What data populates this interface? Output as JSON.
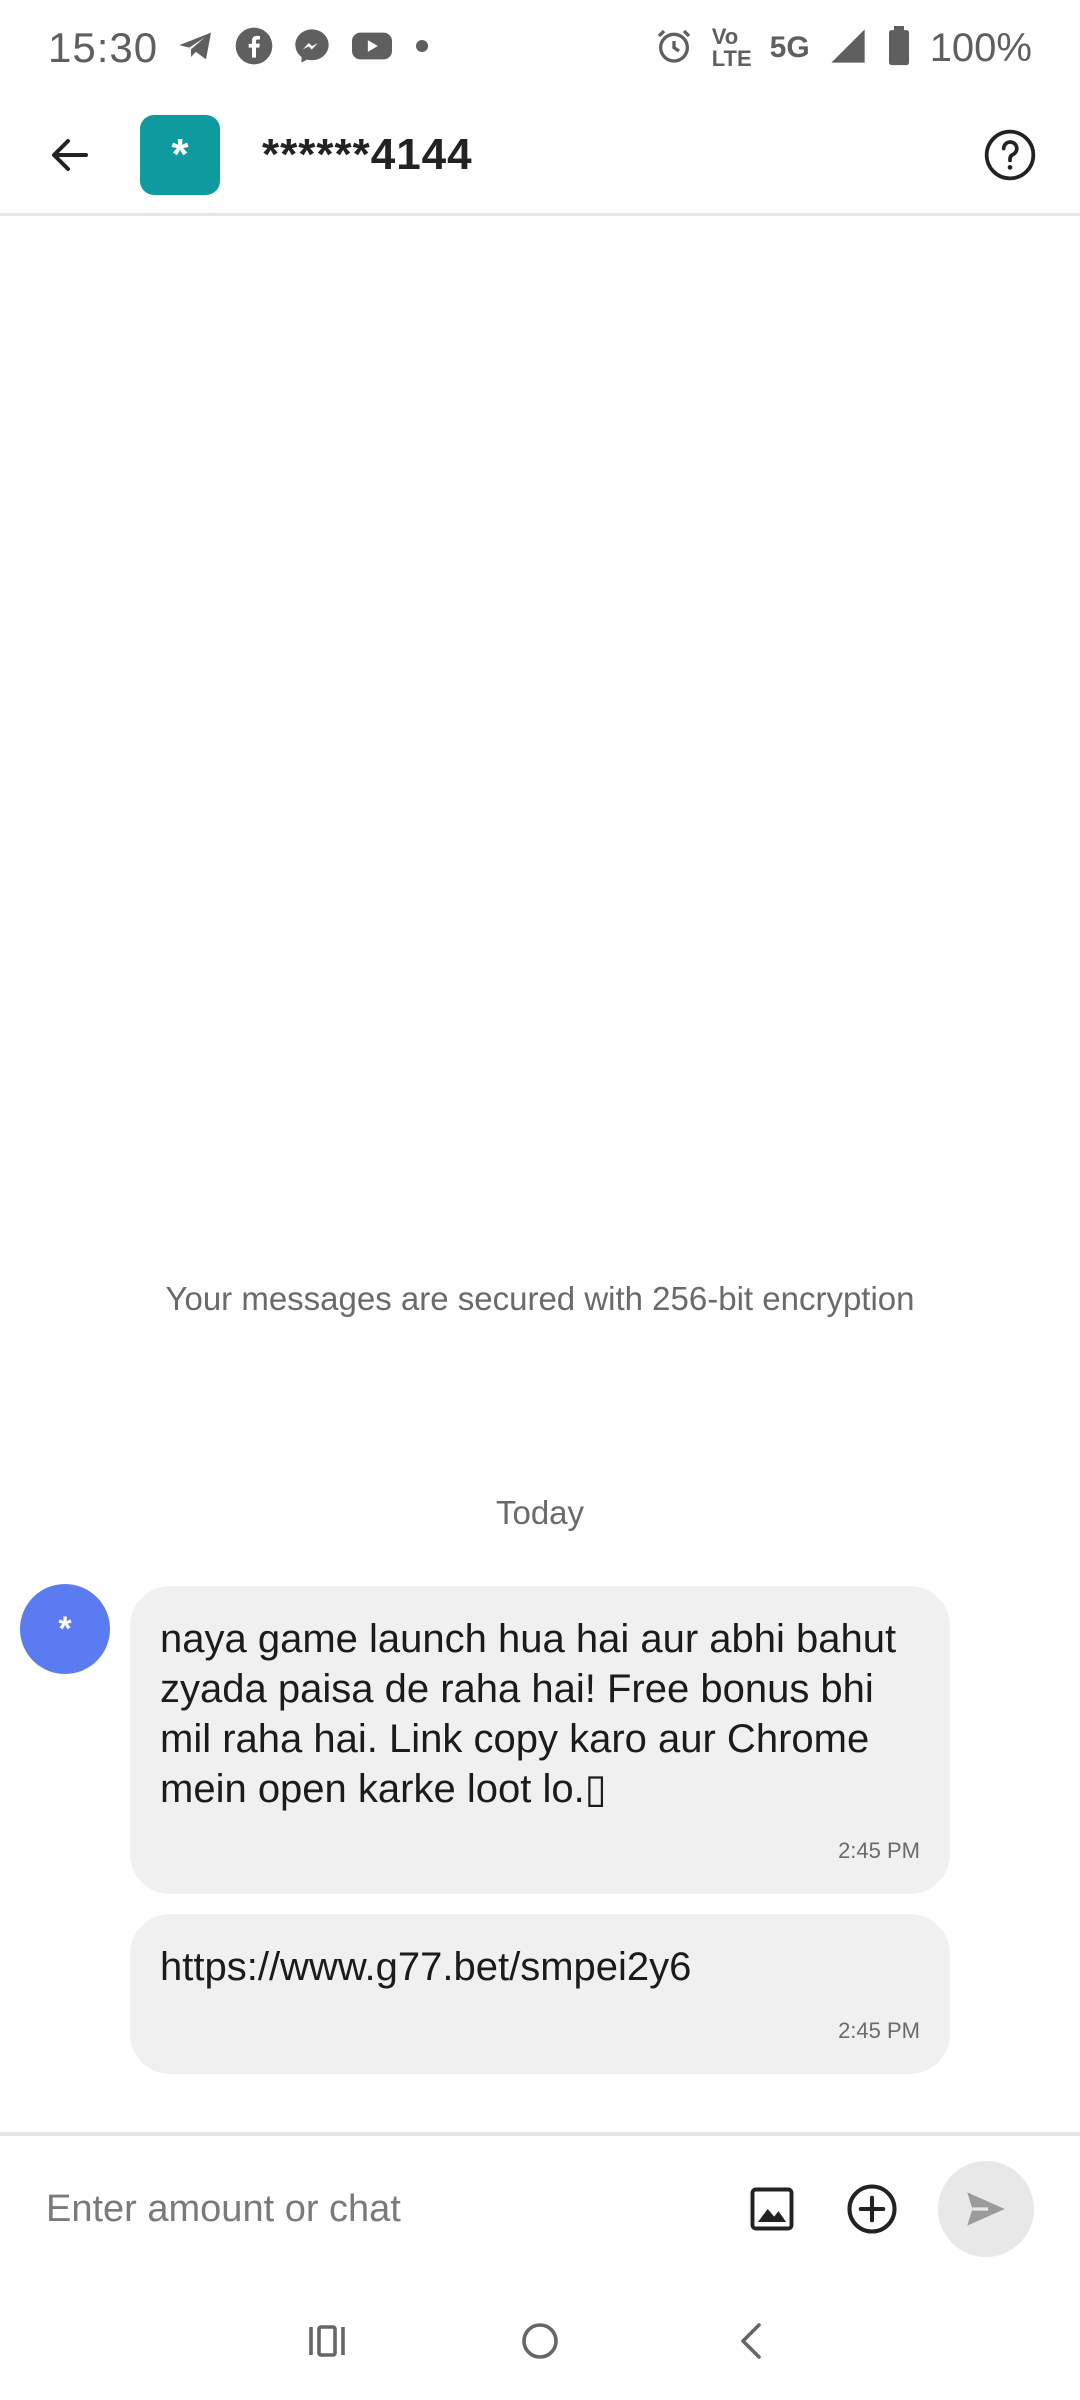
{
  "status_bar": {
    "time": "15:30",
    "network_top": "Vo",
    "network_bottom": "LTE",
    "signal_label": "5G",
    "battery_pct": "100%",
    "icons": [
      "telegram-icon",
      "facebook-icon",
      "messenger-icon",
      "youtube-icon",
      "dot-icon",
      "alarm-icon",
      "volte-icon",
      "5g-icon",
      "signal-icon",
      "battery-icon"
    ]
  },
  "header": {
    "avatar_text": "*",
    "contact_name": "******4144",
    "avatar_color": "#0f9aa0"
  },
  "chat": {
    "encryption_note": "Your messages are secured with 256-bit encryption",
    "day_label": "Today",
    "sender_avatar_text": "*",
    "sender_avatar_color": "#5b7cf0",
    "messages": [
      {
        "text": "naya game launch hua hai aur abhi bahut zyada paisa de raha hai! Free bonus bhi mil raha hai. Link copy karo aur Chrome mein open karke loot lo.▯",
        "time": "2:45 PM"
      },
      {
        "text": "https://www.g77.bet/smpei2y6",
        "time": "2:45 PM"
      }
    ]
  },
  "composer": {
    "placeholder": "Enter amount or chat",
    "value": ""
  }
}
